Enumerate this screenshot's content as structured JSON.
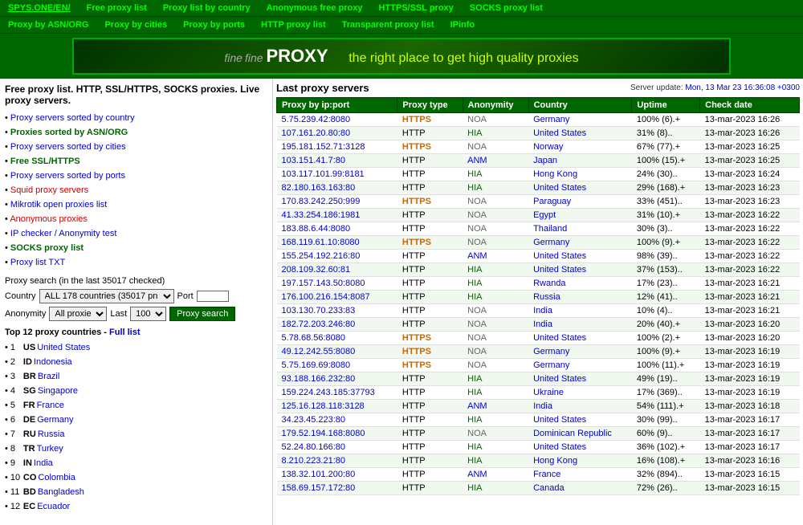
{
  "nav1": {
    "items": [
      {
        "label": "SPYS.ONE/EN/",
        "href": "#",
        "active": false
      },
      {
        "label": "Free proxy list",
        "href": "#",
        "active": false
      },
      {
        "label": "Proxy list by country",
        "href": "#",
        "active": false
      },
      {
        "label": "Anonymous free proxy",
        "href": "#",
        "active": false
      },
      {
        "label": "HTTPS/SSL proxy",
        "href": "#",
        "active": false
      },
      {
        "label": "SOCKS proxy list",
        "href": "#",
        "active": false
      }
    ]
  },
  "nav2": {
    "items": [
      {
        "label": "Proxy by ASN/ORG",
        "href": "#",
        "active": false
      },
      {
        "label": "Proxy by cities",
        "href": "#",
        "active": false
      },
      {
        "label": "Proxy by ports",
        "href": "#",
        "active": false
      },
      {
        "label": "HTTP proxy list",
        "href": "#",
        "active": false
      },
      {
        "label": "Transparent proxy list",
        "href": "#",
        "active": false
      },
      {
        "label": "IPinfo",
        "href": "#",
        "active": false
      }
    ]
  },
  "banner": {
    "fine": "fine",
    "brand": "fine PROXY",
    "tagline": "the right place to get high quality proxies"
  },
  "sidebar": {
    "title": "Free proxy list. HTTP, SSL/HTTPS, SOCKS proxies. Live proxy servers.",
    "links": [
      {
        "label": "Proxy servers sorted by country",
        "color": "normal"
      },
      {
        "label": "Proxies sorted by ASN/ORG",
        "color": "green"
      },
      {
        "label": "Proxy servers sorted by cities",
        "color": "normal"
      },
      {
        "label": "Free SSL/HTTPS",
        "color": "green"
      },
      {
        "label": "Proxy servers sorted by ports",
        "color": "normal"
      },
      {
        "label": "Squid proxy servers",
        "color": "red"
      },
      {
        "label": "Mikrotik open proxies list",
        "color": "normal"
      },
      {
        "label": "Anonymous proxies",
        "color": "red"
      },
      {
        "label": "IP checker / Anonymity test",
        "color": "normal"
      },
      {
        "label": "SOCKS proxy list",
        "color": "green"
      },
      {
        "label": "Proxy list TXT",
        "color": "normal"
      }
    ],
    "search": {
      "title": "Proxy search (in the last 35017 checked)",
      "country_label": "Country",
      "country_value": "ALL 178 countries (35017 pn",
      "port_label": "Port",
      "anonymity_label": "Anonymity",
      "anonymity_value": "All proxie",
      "last_label": "Last",
      "last_value": "100",
      "button_label": "Proxy search"
    },
    "top_countries": {
      "title": "Top 12 proxy countries",
      "full_list_label": "Full list",
      "items": [
        {
          "num": "1",
          "code": "US",
          "name": "United States"
        },
        {
          "num": "2",
          "code": "ID",
          "name": "Indonesia"
        },
        {
          "num": "3",
          "code": "BR",
          "name": "Brazil"
        },
        {
          "num": "4",
          "code": "SG",
          "name": "Singapore"
        },
        {
          "num": "5",
          "code": "FR",
          "name": "France"
        },
        {
          "num": "6",
          "code": "DE",
          "name": "Germany"
        },
        {
          "num": "7",
          "code": "RU",
          "name": "Russia"
        },
        {
          "num": "8",
          "code": "TR",
          "name": "Turkey"
        },
        {
          "num": "9",
          "code": "IN",
          "name": "India"
        },
        {
          "num": "10",
          "code": "CO",
          "name": "Colombia"
        },
        {
          "num": "11",
          "code": "BD",
          "name": "Bangladesh"
        },
        {
          "num": "12",
          "code": "EC",
          "name": "Ecuador"
        }
      ]
    }
  },
  "proxy_table": {
    "section_title": "Last proxy servers",
    "server_update_label": "Server update:",
    "server_update_value": "Mon, 13 Mar 23 16:36:08 +0300",
    "columns": [
      "Proxy by ip:port",
      "Proxy type",
      "Anonymity",
      "Country",
      "Uptime",
      "Check date"
    ],
    "rows": [
      {
        "ip": "5.75.239.42:8080",
        "type": "HTTPS",
        "anon": "NOA",
        "country": "Germany",
        "uptime": "100% (6).+",
        "date": "13-mar-2023 16:26"
      },
      {
        "ip": "107.161.20.80:80",
        "type": "HTTP",
        "anon": "HIA",
        "country": "United States",
        "uptime": "31% (8)..",
        "date": "13-mar-2023 16:26"
      },
      {
        "ip": "195.181.152.71:3128",
        "type": "HTTPS",
        "anon": "NOA",
        "country": "Norway",
        "uptime": "67% (77).+",
        "date": "13-mar-2023 16:25"
      },
      {
        "ip": "103.151.41.7:80",
        "type": "HTTP",
        "anon": "ANM",
        "country": "Japan",
        "uptime": "100% (15).+",
        "date": "13-mar-2023 16:25"
      },
      {
        "ip": "103.117.101.99:8181",
        "type": "HTTP",
        "anon": "HIA",
        "country": "Hong Kong",
        "uptime": "24% (30)..",
        "date": "13-mar-2023 16:24"
      },
      {
        "ip": "82.180.163.163:80",
        "type": "HTTP",
        "anon": "HIA",
        "country": "United States",
        "uptime": "29% (168).+",
        "date": "13-mar-2023 16:23"
      },
      {
        "ip": "170.83.242.250:999",
        "type": "HTTPS",
        "anon": "NOA",
        "country": "Paraguay",
        "uptime": "33% (451)..",
        "date": "13-mar-2023 16:23"
      },
      {
        "ip": "41.33.254.186:1981",
        "type": "HTTP",
        "anon": "NOA",
        "country": "Egypt",
        "uptime": "31% (10).+",
        "date": "13-mar-2023 16:22"
      },
      {
        "ip": "183.88.6.44:8080",
        "type": "HTTP",
        "anon": "NOA",
        "country": "Thailand",
        "uptime": "30% (3)..",
        "date": "13-mar-2023 16:22"
      },
      {
        "ip": "168.119.61.10:8080",
        "type": "HTTPS",
        "anon": "NOA",
        "country": "Germany",
        "uptime": "100% (9).+",
        "date": "13-mar-2023 16:22"
      },
      {
        "ip": "155.254.192.216:80",
        "type": "HTTP",
        "anon": "ANM",
        "country": "United States",
        "uptime": "98% (39)..",
        "date": "13-mar-2023 16:22"
      },
      {
        "ip": "208.109.32.60:81",
        "type": "HTTP",
        "anon": "HIA",
        "country": "United States",
        "uptime": "37% (153)..",
        "date": "13-mar-2023 16:22"
      },
      {
        "ip": "197.157.143.50:8080",
        "type": "HTTP",
        "anon": "HIA",
        "country": "Rwanda",
        "uptime": "17% (23)..",
        "date": "13-mar-2023 16:21"
      },
      {
        "ip": "176.100.216.154:8087",
        "type": "HTTP",
        "anon": "HIA",
        "country": "Russia",
        "uptime": "12% (41)..",
        "date": "13-mar-2023 16:21"
      },
      {
        "ip": "103.130.70.233:83",
        "type": "HTTP",
        "anon": "NOA",
        "country": "India",
        "uptime": "10% (4)..",
        "date": "13-mar-2023 16:21"
      },
      {
        "ip": "182.72.203.246:80",
        "type": "HTTP",
        "anon": "NOA",
        "country": "India",
        "uptime": "20% (40).+",
        "date": "13-mar-2023 16:20"
      },
      {
        "ip": "5.78.68.56:8080",
        "type": "HTTPS",
        "anon": "NOA",
        "country": "United States",
        "uptime": "100% (2).+",
        "date": "13-mar-2023 16:20"
      },
      {
        "ip": "49.12.242.55:8080",
        "type": "HTTPS",
        "anon": "NOA",
        "country": "Germany",
        "uptime": "100% (9).+",
        "date": "13-mar-2023 16:19"
      },
      {
        "ip": "5.75.169.69:8080",
        "type": "HTTPS",
        "anon": "NOA",
        "country": "Germany",
        "uptime": "100% (11).+",
        "date": "13-mar-2023 16:19"
      },
      {
        "ip": "93.188.166.232:80",
        "type": "HTTP",
        "anon": "HIA",
        "country": "United States",
        "uptime": "49% (19)..",
        "date": "13-mar-2023 16:19"
      },
      {
        "ip": "159.224.243.185:37793",
        "type": "HTTP",
        "anon": "HIA",
        "country": "Ukraine",
        "uptime": "17% (369)..",
        "date": "13-mar-2023 16:19"
      },
      {
        "ip": "125.16.128.118:3128",
        "type": "HTTP",
        "anon": "ANM",
        "country": "India",
        "uptime": "54% (111).+",
        "date": "13-mar-2023 16:18"
      },
      {
        "ip": "34.23.45.223:80",
        "type": "HTTP",
        "anon": "HIA",
        "country": "United States",
        "uptime": "30% (99)..",
        "date": "13-mar-2023 16:17"
      },
      {
        "ip": "179.52.194.168:8080",
        "type": "HTTP",
        "anon": "NOA",
        "country": "Dominican Republic",
        "uptime": "60% (9)..",
        "date": "13-mar-2023 16:17"
      },
      {
        "ip": "52.24.80.166:80",
        "type": "HTTP",
        "anon": "HIA",
        "country": "United States",
        "uptime": "36% (102).+",
        "date": "13-mar-2023 16:17"
      },
      {
        "ip": "8.210.223.21:80",
        "type": "HTTP",
        "anon": "HIA",
        "country": "Hong Kong",
        "uptime": "16% (108).+",
        "date": "13-mar-2023 16:16"
      },
      {
        "ip": "138.32.101.200:80",
        "type": "HTTP",
        "anon": "ANM",
        "country": "France",
        "uptime": "32% (894)..",
        "date": "13-mar-2023 16:15"
      },
      {
        "ip": "158.69.157.172:80",
        "type": "HTTP",
        "anon": "HIA",
        "country": "Canada",
        "uptime": "72% (26)..",
        "date": "13-mar-2023 16:15"
      }
    ]
  }
}
